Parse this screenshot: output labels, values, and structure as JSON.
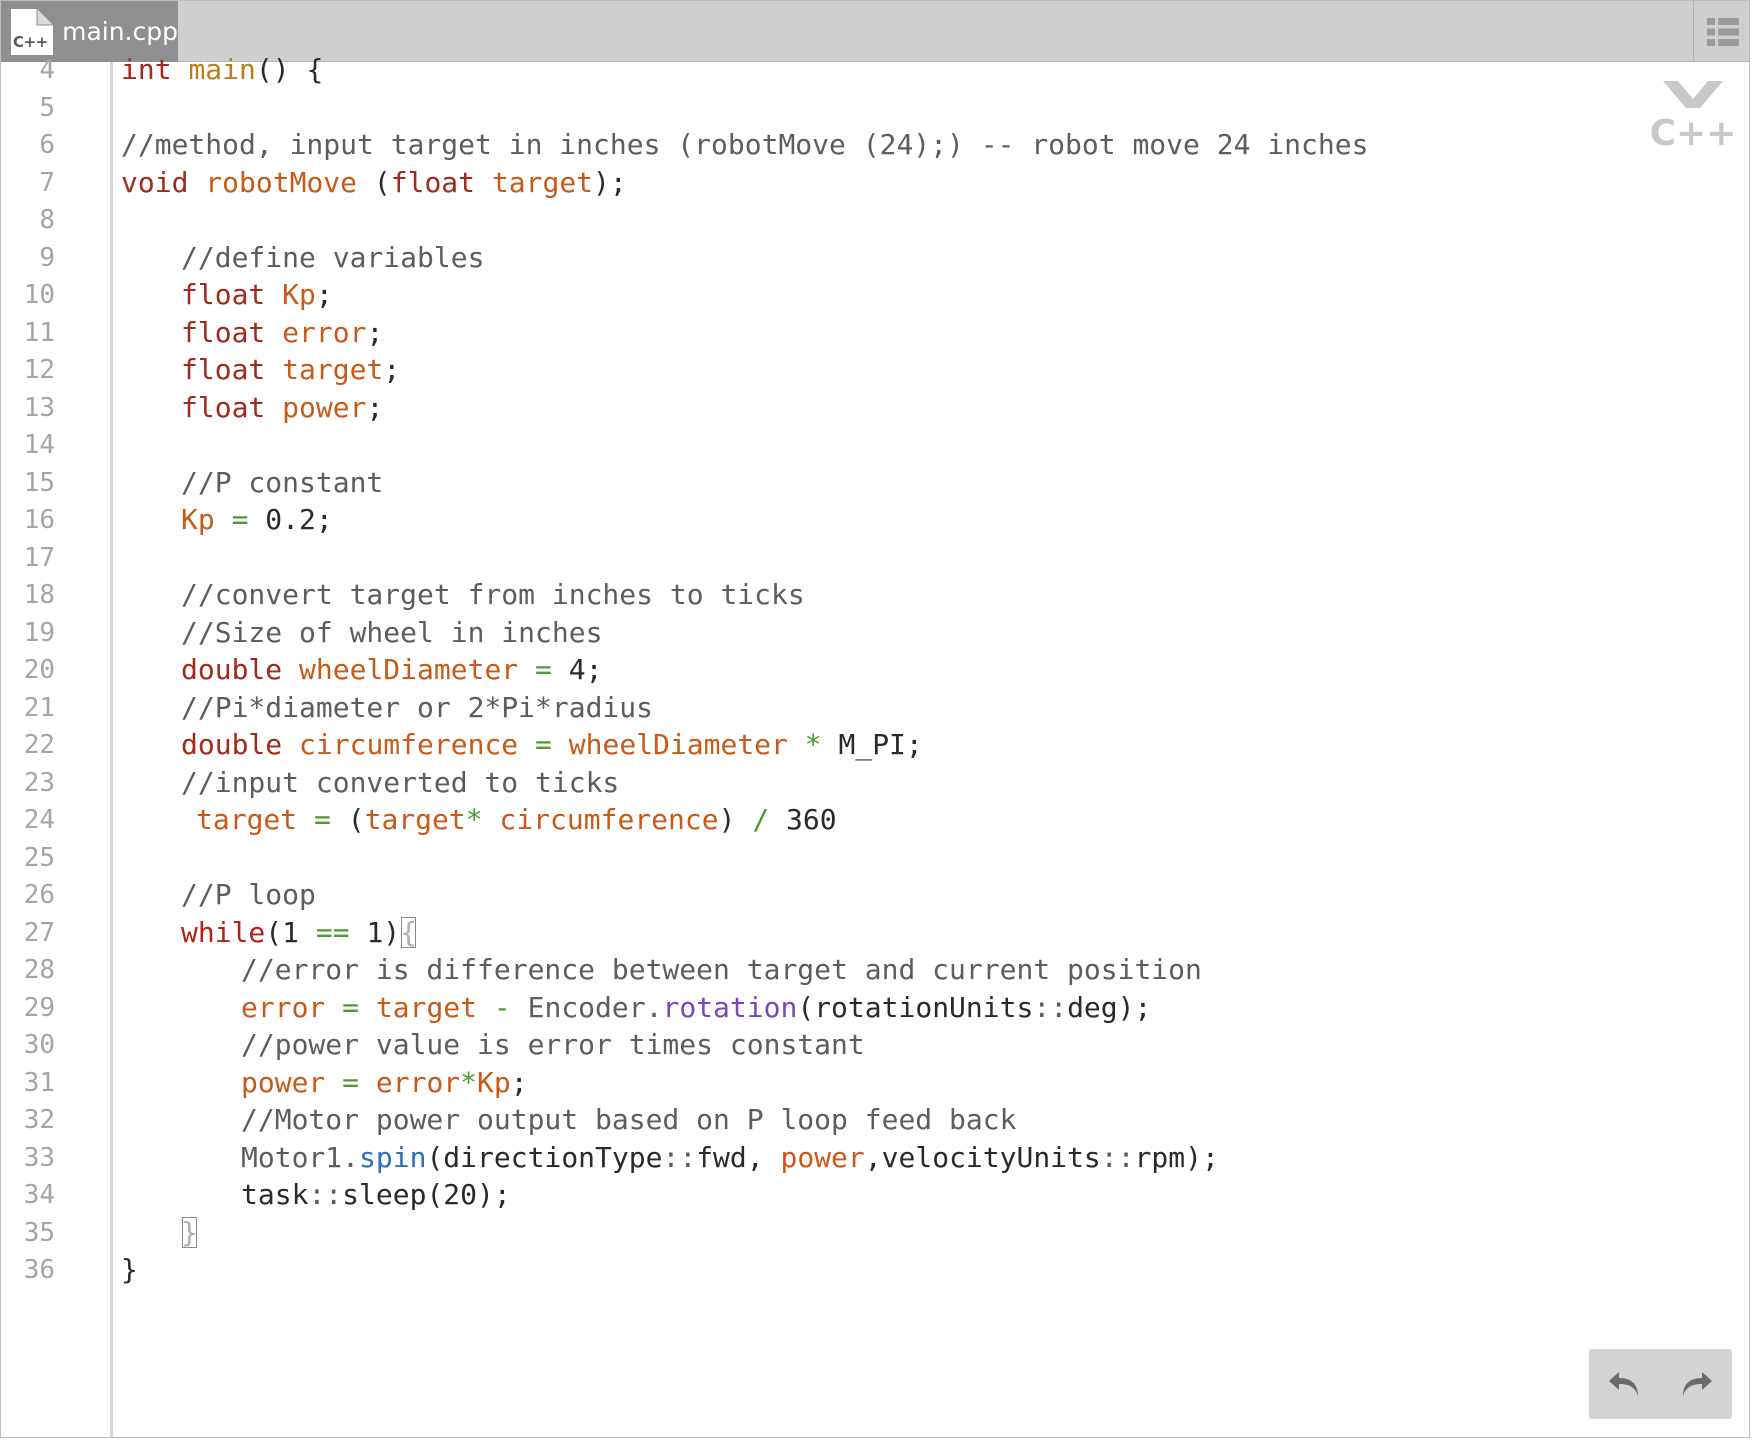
{
  "tab": {
    "label": "main.cpp",
    "icon_label": "C++"
  },
  "logo": {
    "label": "C++"
  },
  "gutter": {
    "start": 4,
    "end": 36
  },
  "colors": {
    "keyword": "#a02a1c",
    "identifier": "#c85a18",
    "function": "#b48218",
    "comment": "#5d5d5d",
    "operator": "#4f9a2d",
    "method_purple": "#7b47b8",
    "method_blue": "#2f6fb5",
    "tab_bg": "#8f8f8f",
    "toolbar_bg": "#cfcfcf"
  },
  "code": [
    {
      "n": 4,
      "indent": 0,
      "t": [
        [
          "kw",
          "int"
        ],
        [
          "plain",
          " "
        ],
        [
          "fn",
          "main"
        ],
        [
          "plain",
          "() {"
        ]
      ]
    },
    {
      "n": 5,
      "indent": 0,
      "t": []
    },
    {
      "n": 6,
      "indent": 0,
      "t": [
        [
          "cm",
          "//method, input target in inches (robotMove (24);) -- robot move 24 inches"
        ]
      ]
    },
    {
      "n": 7,
      "indent": 0,
      "t": [
        [
          "kw",
          "void"
        ],
        [
          "plain",
          " "
        ],
        [
          "id",
          "robotMove"
        ],
        [
          "plain",
          " ("
        ],
        [
          "kw",
          "float"
        ],
        [
          "plain",
          " "
        ],
        [
          "id",
          "target"
        ],
        [
          "plain",
          ");"
        ]
      ]
    },
    {
      "n": 8,
      "indent": 0,
      "t": []
    },
    {
      "n": 9,
      "indent": 4,
      "t": [
        [
          "cm",
          "//define variables"
        ]
      ]
    },
    {
      "n": 10,
      "indent": 4,
      "t": [
        [
          "kw",
          "float"
        ],
        [
          "plain",
          " "
        ],
        [
          "id",
          "Kp"
        ],
        [
          "plain",
          ";"
        ]
      ]
    },
    {
      "n": 11,
      "indent": 4,
      "t": [
        [
          "kw",
          "float"
        ],
        [
          "plain",
          " "
        ],
        [
          "id",
          "error"
        ],
        [
          "plain",
          ";"
        ]
      ]
    },
    {
      "n": 12,
      "indent": 4,
      "t": [
        [
          "kw",
          "float"
        ],
        [
          "plain",
          " "
        ],
        [
          "id",
          "target"
        ],
        [
          "plain",
          ";"
        ]
      ]
    },
    {
      "n": 13,
      "indent": 4,
      "t": [
        [
          "kw",
          "float"
        ],
        [
          "plain",
          " "
        ],
        [
          "id",
          "power"
        ],
        [
          "plain",
          ";"
        ]
      ]
    },
    {
      "n": 14,
      "indent": 0,
      "t": []
    },
    {
      "n": 15,
      "indent": 4,
      "t": [
        [
          "cm",
          "//P constant"
        ]
      ]
    },
    {
      "n": 16,
      "indent": 4,
      "t": [
        [
          "id",
          "Kp"
        ],
        [
          "plain",
          " "
        ],
        [
          "op",
          "="
        ],
        [
          "plain",
          " 0.2;"
        ]
      ]
    },
    {
      "n": 17,
      "indent": 0,
      "t": []
    },
    {
      "n": 18,
      "indent": 4,
      "t": [
        [
          "cm",
          "//convert target from inches to ticks"
        ]
      ]
    },
    {
      "n": 19,
      "indent": 4,
      "t": [
        [
          "cm",
          "//Size of wheel in inches"
        ]
      ]
    },
    {
      "n": 20,
      "indent": 4,
      "t": [
        [
          "kw",
          "double"
        ],
        [
          "plain",
          " "
        ],
        [
          "id",
          "wheelDiameter"
        ],
        [
          "plain",
          " "
        ],
        [
          "op",
          "="
        ],
        [
          "plain",
          " 4;"
        ]
      ]
    },
    {
      "n": 21,
      "indent": 4,
      "t": [
        [
          "cm",
          "//Pi*diameter or 2*Pi*radius"
        ]
      ]
    },
    {
      "n": 22,
      "indent": 4,
      "t": [
        [
          "kw",
          "double"
        ],
        [
          "plain",
          " "
        ],
        [
          "id",
          "circumference"
        ],
        [
          "plain",
          " "
        ],
        [
          "op",
          "="
        ],
        [
          "plain",
          " "
        ],
        [
          "id",
          "wheelDiameter"
        ],
        [
          "plain",
          " "
        ],
        [
          "op",
          "*"
        ],
        [
          "plain",
          " M_PI;"
        ]
      ]
    },
    {
      "n": 23,
      "indent": 4,
      "t": [
        [
          "cm",
          "//input converted to ticks"
        ]
      ]
    },
    {
      "n": 24,
      "indent": 5,
      "t": [
        [
          "id",
          "target"
        ],
        [
          "plain",
          " "
        ],
        [
          "op",
          "="
        ],
        [
          "plain",
          " ("
        ],
        [
          "id",
          "target"
        ],
        [
          "op",
          "*"
        ],
        [
          "plain",
          " "
        ],
        [
          "id",
          "circumference"
        ],
        [
          "plain",
          ") "
        ],
        [
          "op",
          "/"
        ],
        [
          "plain",
          " 360"
        ]
      ]
    },
    {
      "n": 25,
      "indent": 0,
      "t": []
    },
    {
      "n": 26,
      "indent": 4,
      "t": [
        [
          "cm",
          "//P loop"
        ]
      ]
    },
    {
      "n": 27,
      "indent": 4,
      "t": [
        [
          "kw2",
          "while"
        ],
        [
          "plain",
          "(1 "
        ],
        [
          "op",
          "=="
        ],
        [
          "plain",
          " 1)"
        ],
        [
          "brk",
          "{"
        ]
      ]
    },
    {
      "n": 28,
      "indent": 8,
      "t": [
        [
          "cm",
          "//error is difference between target and current position"
        ]
      ]
    },
    {
      "n": 29,
      "indent": 8,
      "t": [
        [
          "id",
          "error"
        ],
        [
          "plain",
          " "
        ],
        [
          "op",
          "="
        ],
        [
          "plain",
          " "
        ],
        [
          "id",
          "target"
        ],
        [
          "plain",
          " "
        ],
        [
          "op",
          "-"
        ],
        [
          "plain",
          " "
        ],
        [
          "grey",
          "Encoder"
        ],
        [
          "grey",
          "."
        ],
        [
          "me",
          "rotation"
        ],
        [
          "plain",
          "(rotationUnits"
        ],
        [
          "grey",
          "::"
        ],
        [
          "plain",
          "deg);"
        ]
      ]
    },
    {
      "n": 30,
      "indent": 8,
      "t": [
        [
          "cm",
          "//power value is error times constant"
        ]
      ]
    },
    {
      "n": 31,
      "indent": 8,
      "t": [
        [
          "id",
          "power"
        ],
        [
          "plain",
          " "
        ],
        [
          "op",
          "="
        ],
        [
          "plain",
          " "
        ],
        [
          "id",
          "error"
        ],
        [
          "op",
          "*"
        ],
        [
          "id",
          "Kp"
        ],
        [
          "plain",
          ";"
        ]
      ]
    },
    {
      "n": 32,
      "indent": 8,
      "t": [
        [
          "cm",
          "//Motor power output based on P loop feed back"
        ]
      ]
    },
    {
      "n": 33,
      "indent": 8,
      "t": [
        [
          "grey",
          "Motor1"
        ],
        [
          "grey",
          "."
        ],
        [
          "me2",
          "spin"
        ],
        [
          "plain",
          "(directionType"
        ],
        [
          "grey",
          "::"
        ],
        [
          "plain",
          "fwd, "
        ],
        [
          "id",
          "power"
        ],
        [
          "plain",
          ",velocityUnits"
        ],
        [
          "grey",
          "::"
        ],
        [
          "plain",
          "rpm);"
        ]
      ]
    },
    {
      "n": 34,
      "indent": 8,
      "t": [
        [
          "plain",
          "task"
        ],
        [
          "grey",
          "::"
        ],
        [
          "plain",
          "sleep(20);"
        ]
      ]
    },
    {
      "n": 35,
      "indent": 4,
      "t": [
        [
          "brk",
          "}"
        ]
      ]
    },
    {
      "n": 36,
      "indent": 0,
      "t": [
        [
          "plain",
          "}"
        ]
      ]
    }
  ]
}
